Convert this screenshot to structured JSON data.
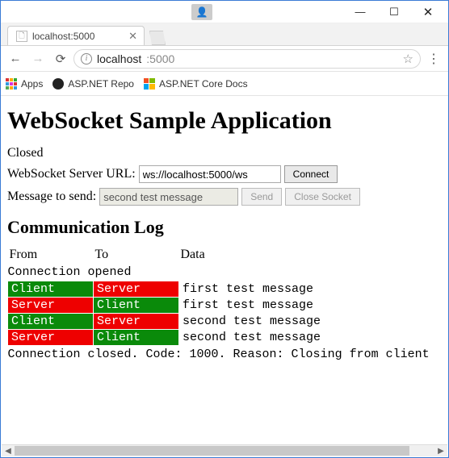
{
  "window": {
    "min_icon": "—",
    "max_icon": "☐",
    "close_icon": "✕",
    "user_icon": "👤"
  },
  "tab": {
    "title": "localhost:5000",
    "close_icon": "✕"
  },
  "omnibox": {
    "host": "localhost",
    "port": ":5000"
  },
  "bookmarks": {
    "apps": "Apps",
    "repo": "ASP.NET Repo",
    "docs": "ASP.NET Core Docs"
  },
  "page": {
    "title": "WebSocket Sample Application",
    "status": "Closed",
    "url_label": "WebSocket Server URL:",
    "url_value": "ws://localhost:5000/ws",
    "connect_btn": "Connect",
    "msg_label": "Message to send:",
    "msg_value": "second test message",
    "send_btn": "Send",
    "close_btn": "Close Socket",
    "log_heading": "Communication Log",
    "headers": {
      "from": "From",
      "to": "To",
      "data": "Data"
    },
    "labels": {
      "client": "Client",
      "server": "Server"
    },
    "opened_row": "Connection opened",
    "rows": [
      {
        "from": "client",
        "to": "server",
        "data": "first test message"
      },
      {
        "from": "server",
        "to": "client",
        "data": "first test message"
      },
      {
        "from": "client",
        "to": "server",
        "data": "second test message"
      },
      {
        "from": "server",
        "to": "client",
        "data": "second test message"
      }
    ],
    "closed_row": "Connection closed. Code: 1000. Reason: Closing from client"
  }
}
